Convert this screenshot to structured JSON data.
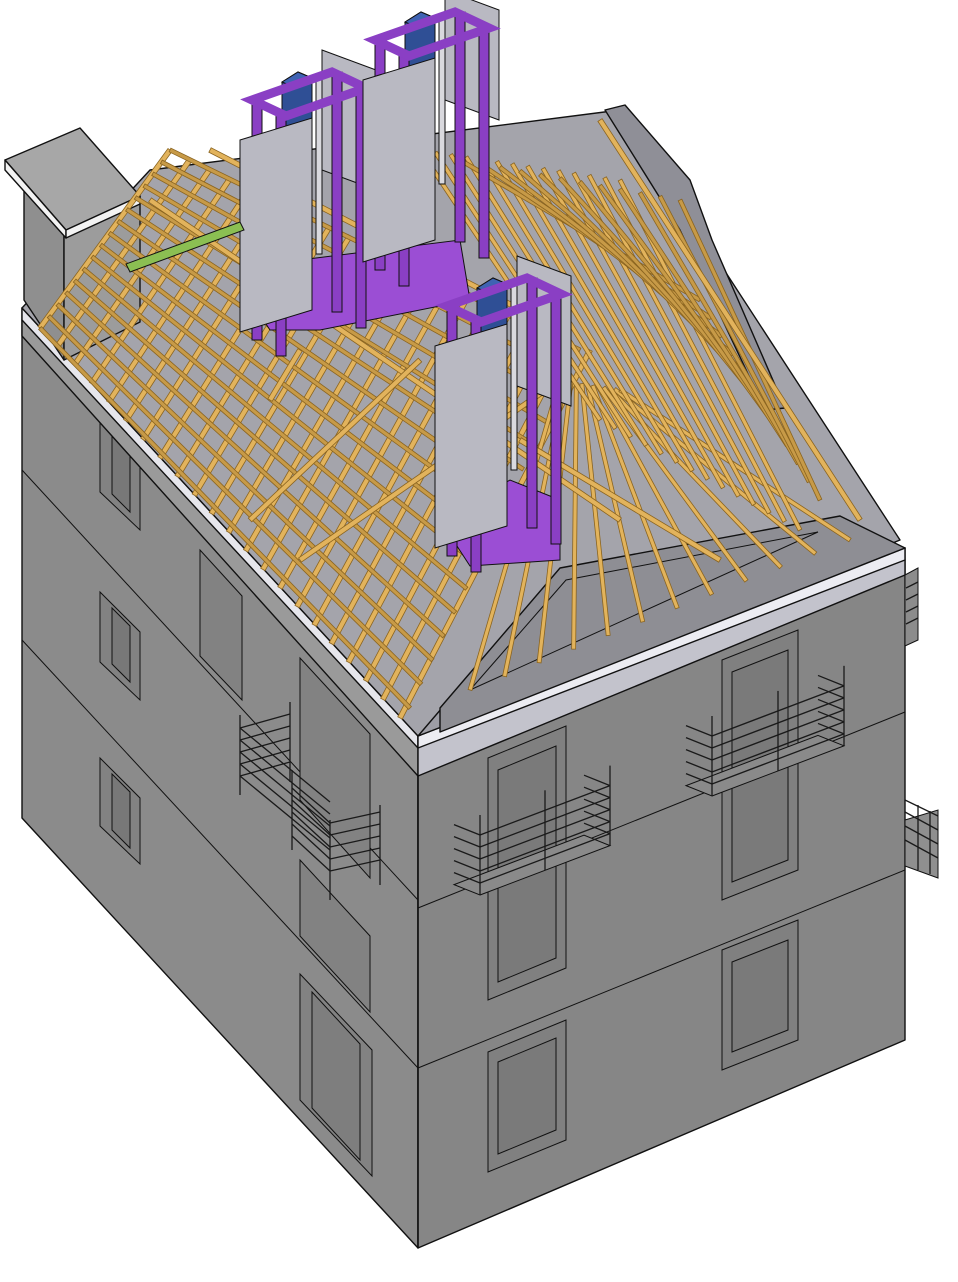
{
  "colors": {
    "wall_left": "#8a8a8a",
    "wall_front": "#878787",
    "wall_dark": "#7d7d7d",
    "roof_deck": "#a8a8ae",
    "cornice": "#c9c9d2",
    "timber": "#e2b35c",
    "timber_dark": "#c79a47",
    "frame_purple": "#8a3fc4",
    "purple_fill": "#9d4fd6",
    "duct_blue": "#2f4f95",
    "panel": "#b9b9c2",
    "pipe_green": "#7fb04a",
    "chimney": "#a3a3a3",
    "chimney_cap": "#f2f2f2"
  },
  "icons": {
    "building": "building-isometric-icon",
    "chimney": "chimney-icon",
    "roof_truss": "roof-truss-icon",
    "shaft_frame": "shaft-frame-icon",
    "balcony": "balcony-railing-icon"
  }
}
